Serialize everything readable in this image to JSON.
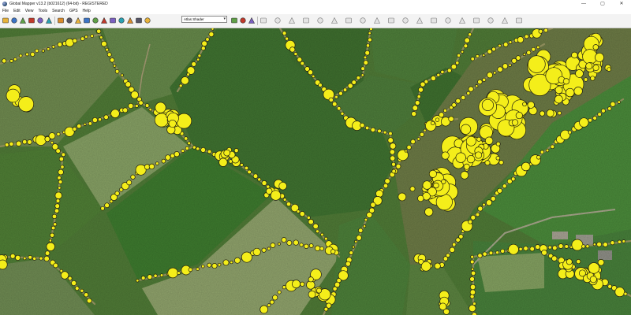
{
  "window": {
    "title": "Global Mapper v13.2 (b021612) (64-bit) - REGISTERED",
    "minimize": "—",
    "maximize": "▢",
    "close": "✕"
  },
  "menu": [
    "File",
    "Edit",
    "View",
    "Tools",
    "Search",
    "GPS",
    "Help"
  ],
  "toolbar": {
    "shader_value": "Atlas Shader",
    "icons": [
      "open-folder-icon",
      "save-icon",
      "export-icon",
      "print-icon",
      "copy-icon",
      "help-icon",
      "zoom-in-icon",
      "zoom-out-icon",
      "globe-icon",
      "layer-control-icon",
      "pointer-icon",
      "pan-icon",
      "measure-icon",
      "grid-icon",
      "3d-view-icon",
      "path-profile-icon",
      "home-icon",
      "shader-dropdown",
      "light-icon",
      "contour-icon",
      "vertical-exag-icon",
      "digitizer-icon",
      "feature-info-icon",
      "area-tool-icon",
      "line-tool-icon",
      "point-tool-icon",
      "buffer-icon",
      "split-icon",
      "join-icon",
      "rotate-icon",
      "scale-icon",
      "crop-icon",
      "reshape-icon",
      "vertex-icon",
      "create-area-icon",
      "create-line-icon",
      "create-point-icon",
      "range-ring-icon",
      "text-icon",
      "snap-icon"
    ]
  },
  "colors": {
    "marker_fill": "#f4ee1a",
    "marker_stroke": "#1e1e10",
    "field_dark": "#3b6d2e",
    "field_light": "#7a9458",
    "hedge": "#8c8a5a"
  }
}
